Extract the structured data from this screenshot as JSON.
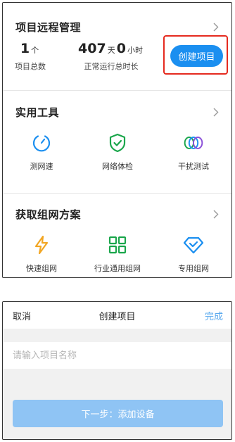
{
  "project_mgmt": {
    "title": "项目远程管理",
    "project_count": "1",
    "project_count_unit": "个",
    "project_count_label": "项目总数",
    "days": "407",
    "days_unit": "天",
    "hours": "0",
    "hours_unit": "小时",
    "uptime_label": "正常运行总时长",
    "create_button": "创建项目"
  },
  "tools": {
    "title": "实用工具",
    "items": [
      {
        "label": "测网速",
        "icon": "speedometer-icon"
      },
      {
        "label": "网络体检",
        "icon": "shield-check-icon"
      },
      {
        "label": "干扰测试",
        "icon": "interference-rings-icon"
      }
    ]
  },
  "solutions": {
    "title": "获取组网方案",
    "items": [
      {
        "label": "快速组网",
        "icon": "lightning-icon"
      },
      {
        "label": "行业通用组网",
        "icon": "grid-icon"
      },
      {
        "label": "专用组网",
        "icon": "diamond-check-icon"
      }
    ]
  },
  "dialog": {
    "cancel": "取消",
    "title": "创建项目",
    "done": "完成",
    "input_placeholder": "请输入项目名称",
    "next_button": "下一步：添加设备"
  },
  "colors": {
    "accent": "#1b8ff0",
    "highlight": "#e52a1f",
    "icon_blue": "#1b8ff0",
    "icon_green": "#1aa64b",
    "icon_orange": "#f2a623",
    "disabled_button": "#8fc4f4"
  }
}
